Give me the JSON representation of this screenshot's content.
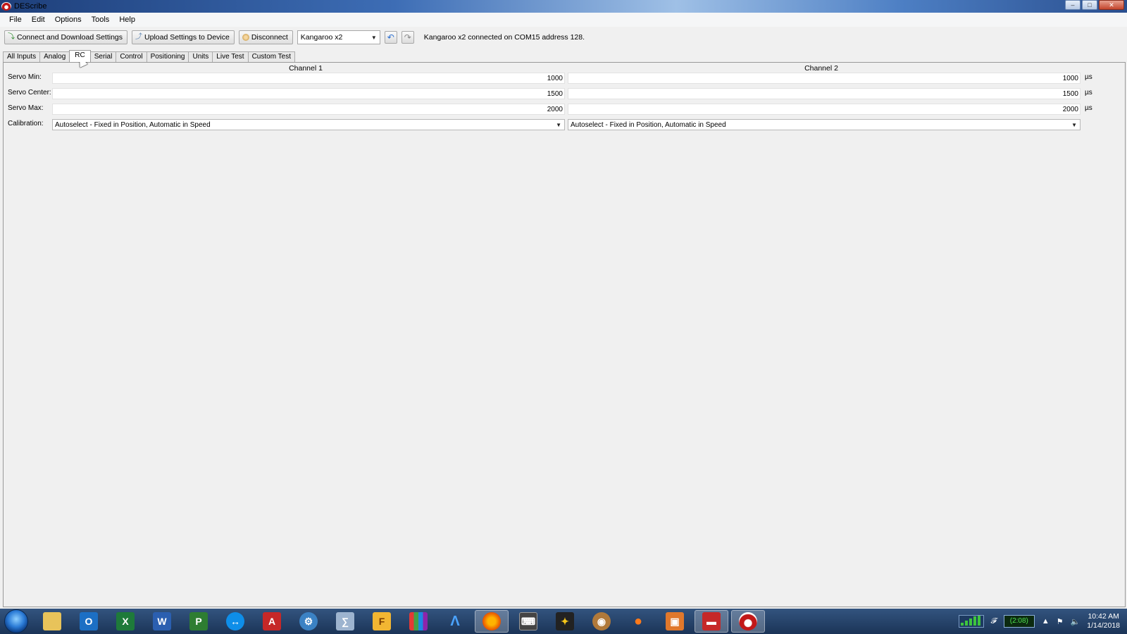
{
  "window": {
    "title": "DEScribe"
  },
  "menu": [
    "File",
    "Edit",
    "Options",
    "Tools",
    "Help"
  ],
  "toolbar": {
    "connect_label": "Connect and Download Settings",
    "upload_label": "Upload Settings to Device",
    "disconnect_label": "Disconnect",
    "device_selected": "Kangaroo x2",
    "status": "Kangaroo x2 connected on COM15 address 128."
  },
  "tabs": [
    "All Inputs",
    "Analog",
    "RC",
    "Serial",
    "Control",
    "Positioning",
    "Units",
    "Live Test",
    "Custom Test"
  ],
  "active_tab": "RC",
  "rc": {
    "channel1_header": "Channel 1",
    "channel2_header": "Channel 2",
    "rows": [
      {
        "label": "Servo Min:",
        "ch1": "1000",
        "ch2": "1000",
        "unit": "µs"
      },
      {
        "label": "Servo Center:",
        "ch1": "1500",
        "ch2": "1500",
        "unit": "µs"
      },
      {
        "label": "Servo Max:",
        "ch1": "2000",
        "ch2": "2000",
        "unit": "µs"
      }
    ],
    "calibration": {
      "label": "Calibration:",
      "ch1": "Autoselect - Fixed in Position, Automatic in Speed",
      "ch2": "Autoselect - Fixed in Position, Automatic in Speed"
    }
  },
  "taskbar": {
    "battery_text": "(2:08)",
    "clock_time": "10:42 AM",
    "clock_date": "1/14/2018"
  }
}
